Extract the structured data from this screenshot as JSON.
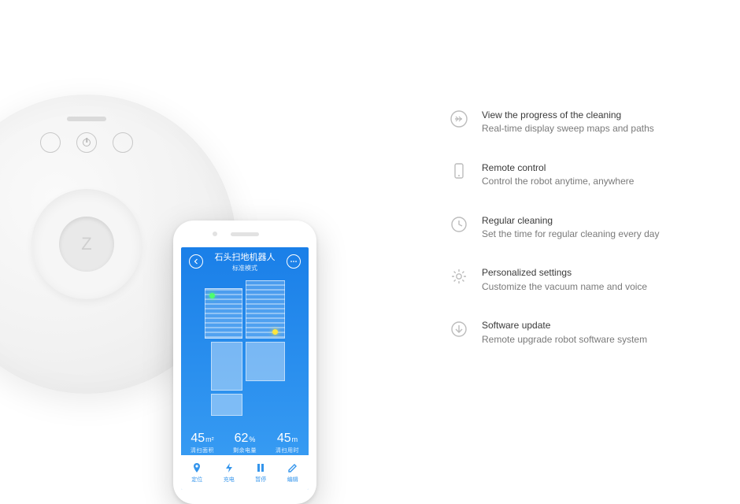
{
  "app": {
    "title": "石头扫地机器人",
    "subtitle": "标准模式"
  },
  "stats": [
    {
      "value": "45",
      "unit": "m²",
      "label": "清扫面积"
    },
    {
      "value": "62",
      "unit": "%",
      "label": "剩余电量"
    },
    {
      "value": "45",
      "unit": "m",
      "label": "清扫用时"
    }
  ],
  "nav": [
    {
      "label": "定位"
    },
    {
      "label": "充电"
    },
    {
      "label": "暂停"
    },
    {
      "label": "编辑"
    }
  ],
  "features": [
    {
      "icon": "progress-icon",
      "title": "View the progress of the cleaning",
      "desc": "Real-time display sweep maps and paths"
    },
    {
      "icon": "remote-icon",
      "title": "Remote control",
      "desc": "Control  the robot anytime, anywhere"
    },
    {
      "icon": "clock-icon",
      "title": "Regular cleaning",
      "desc": "Set the time for regular cleaning every day"
    },
    {
      "icon": "settings-icon",
      "title": "Personalized settings",
      "desc": "Customize the vacuum name and voice"
    },
    {
      "icon": "download-icon",
      "title": "Software update",
      "desc": "Remote upgrade robot software system"
    }
  ],
  "robot_logo": "Z"
}
